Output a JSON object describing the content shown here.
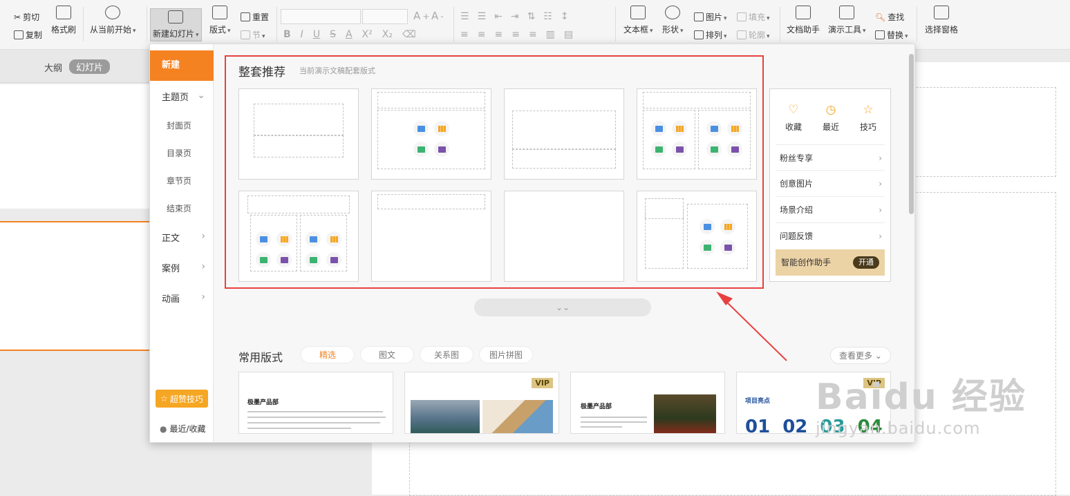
{
  "ribbon": {
    "cut": "剪切",
    "copy": "复制",
    "format_brush": "格式刷",
    "from_current": "从当前开始",
    "new_slide": "新建幻灯片",
    "layout": "版式",
    "reset": "重置",
    "section": "节",
    "text_box": "文本框",
    "shape": "形状",
    "picture": "图片",
    "fill": "填充",
    "arrange": "排列",
    "outline": "轮廓",
    "doc_assistant": "文档助手",
    "present_tools": "演示工具",
    "find": "查找",
    "replace": "替换",
    "select_pane": "选择窗格",
    "font_format_glyphs": [
      "B",
      "I",
      "U",
      "S",
      "A",
      "X²",
      "X₂"
    ]
  },
  "left_panel": {
    "tab_outline": "大纲",
    "tab_slides": "幻灯片"
  },
  "popup": {
    "nav": {
      "new": "新建",
      "theme_page": "主题页",
      "cover": "封面页",
      "toc": "目录页",
      "chapter": "章节页",
      "end": "结束页",
      "body": "正文",
      "case": "案例",
      "animation": "动画",
      "tips_button": "超赞技巧",
      "recent_fav": "最近/收藏"
    },
    "section_title": "整套推荐",
    "section_subtitle": "当前演示文稿配套版式",
    "side_panel": {
      "fav": "收藏",
      "recent": "最近",
      "skill": "技巧",
      "links": [
        "粉丝专享",
        "创意图片",
        "场景介绍",
        "问题反馈"
      ],
      "assistant": "智能创作助手",
      "open": "开通"
    },
    "common_title": "常用版式",
    "filter_tabs": [
      "精选",
      "图文",
      "关系图",
      "图片拼图"
    ],
    "see_more": "查看更多",
    "cards": {
      "vip": "VIP",
      "c1_title": "极墨产品部",
      "c3_title": "极墨产品部",
      "c4_title": "项目亮点",
      "c4_nums": [
        "01",
        "02",
        "03",
        "04"
      ]
    }
  },
  "watermark": {
    "brand": "Baidu 经验",
    "url": "jingyan.baidu.com"
  },
  "colors": {
    "accent_orange": "#f58220",
    "highlight_red": "#e84040",
    "vip_gold": "#dcc485"
  }
}
